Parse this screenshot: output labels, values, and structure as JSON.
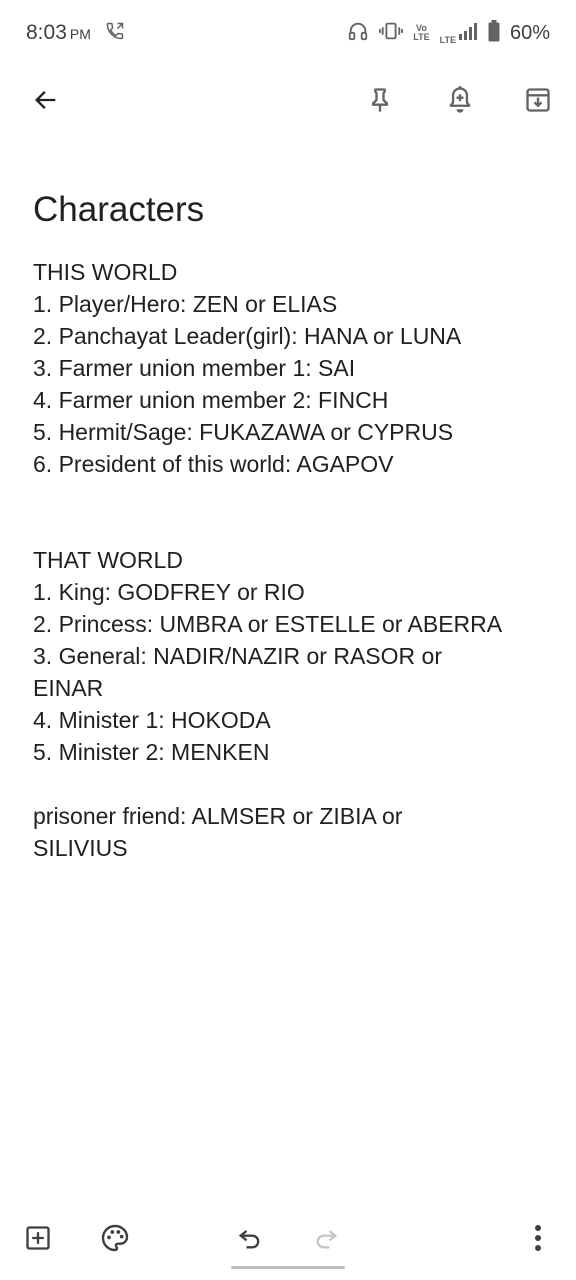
{
  "status_bar": {
    "time": "8:03",
    "ampm": "PM",
    "battery_percent": "60%",
    "icons": [
      "call-forwarding-icon",
      "headset-icon",
      "vibrate-icon",
      "volte-icon",
      "lte-icon",
      "signal-icon",
      "battery-icon"
    ],
    "volte_label": "Vo\nLTE",
    "lte_label": "LTE"
  },
  "toolbar": {
    "icons": [
      "back-arrow-icon",
      "pin-icon",
      "reminder-bell-icon",
      "archive-icon"
    ]
  },
  "note": {
    "title": "Characters",
    "lines": [
      "THIS WORLD",
      "1. Player/Hero: ZEN or ELIAS",
      "2. Panchayat Leader(girl): HANA or LUNA",
      "3. Farmer union member 1: SAI",
      "4. Farmer union member 2: FINCH",
      "5. Hermit/Sage: FUKAZAWA or CYPRUS",
      "6. President of this world: AGAPOV",
      "",
      "",
      "THAT WORLD",
      "1. King: GODFREY or RIO",
      "2. Princess: UMBRA or ESTELLE or ABERRA",
      "3. General: NADIR/NAZIR or RASOR or",
      "EINAR",
      "4. Minister 1: HOKODA",
      "5. Minister 2: MENKEN",
      "",
      "prisoner friend: ALMSER or ZIBIA or",
      "SILIVIUS"
    ]
  },
  "bottom_bar": {
    "icons": [
      "add-box-icon",
      "palette-icon",
      "undo-icon",
      "redo-icon",
      "more-vert-icon"
    ]
  }
}
